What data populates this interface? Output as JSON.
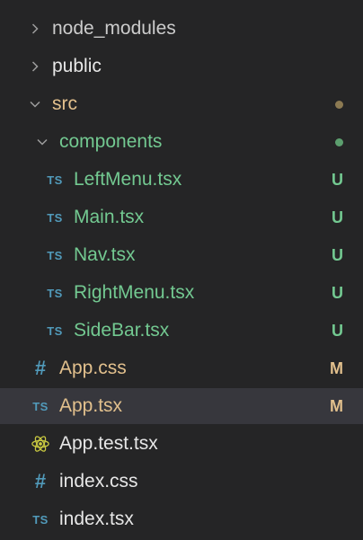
{
  "explorer": {
    "items": [
      {
        "label": "node_modules",
        "kind": "folder",
        "expanded": false,
        "icon": "chevron-right-icon"
      },
      {
        "label": "public",
        "kind": "folder",
        "expanded": false,
        "icon": "chevron-right-icon"
      },
      {
        "label": "src",
        "kind": "folder",
        "expanded": true,
        "icon": "chevron-down-icon",
        "status_dot_color": "#8c7a52"
      },
      {
        "label": "components",
        "kind": "folder",
        "expanded": true,
        "icon": "chevron-down-icon",
        "status_dot_color": "#5c9f6e"
      },
      {
        "label": "LeftMenu.tsx",
        "kind": "file",
        "icon": "typescript-icon",
        "icon_text": "TS",
        "status": "U"
      },
      {
        "label": "Main.tsx",
        "kind": "file",
        "icon": "typescript-icon",
        "icon_text": "TS",
        "status": "U"
      },
      {
        "label": "Nav.tsx",
        "kind": "file",
        "icon": "typescript-icon",
        "icon_text": "TS",
        "status": "U"
      },
      {
        "label": "RightMenu.tsx",
        "kind": "file",
        "icon": "typescript-icon",
        "icon_text": "TS",
        "status": "U"
      },
      {
        "label": "SideBar.tsx",
        "kind": "file",
        "icon": "typescript-icon",
        "icon_text": "TS",
        "status": "U"
      },
      {
        "label": "App.css",
        "kind": "file",
        "icon": "css-hash-icon",
        "icon_text": "#",
        "status": "M"
      },
      {
        "label": "App.tsx",
        "kind": "file",
        "icon": "typescript-icon",
        "icon_text": "TS",
        "status": "M",
        "selected": true
      },
      {
        "label": "App.test.tsx",
        "kind": "file",
        "icon": "react-icon"
      },
      {
        "label": "index.css",
        "kind": "file",
        "icon": "css-hash-icon",
        "icon_text": "#"
      },
      {
        "label": "index.tsx",
        "kind": "file",
        "icon": "typescript-icon",
        "icon_text": "TS"
      }
    ]
  },
  "colors": {
    "background": "#252526",
    "selected_row": "#37373d",
    "untracked": "#73c991",
    "modified": "#e2c08d",
    "ts_icon": "#519aba",
    "react_icon": "#cbcb41",
    "default_text": "#cccccc"
  }
}
